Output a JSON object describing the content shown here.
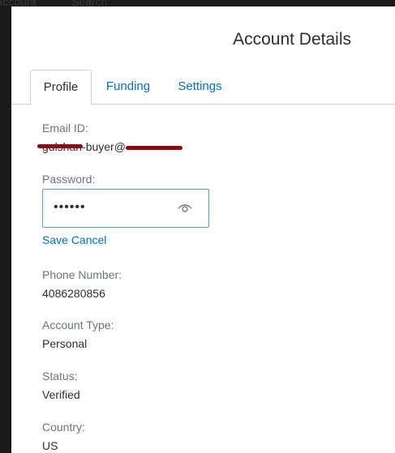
{
  "backdrop": {
    "nav_left": "Account",
    "nav_right": "Search"
  },
  "modal": {
    "title": "Account Details"
  },
  "tabs": [
    {
      "label": "Profile",
      "active": true
    },
    {
      "label": "Funding",
      "active": false
    },
    {
      "label": "Settings",
      "active": false
    }
  ],
  "profile": {
    "email_label": "Email ID:",
    "email_value": "gulshan-buyer@",
    "password_label": "Password:",
    "password_mask": "••••••",
    "password_icon": "eye-icon",
    "save_label": "Save",
    "cancel_label": "Cancel",
    "phone_label": "Phone Number:",
    "phone_value": "4086280856",
    "account_type_label": "Account Type:",
    "account_type_value": "Personal",
    "status_label": "Status:",
    "status_value": "Verified",
    "country_label": "Country:",
    "country_value": "US"
  },
  "colors": {
    "link": "#0070ba",
    "redaction": "#8a0b12",
    "input_border": "#5ca0c8"
  }
}
